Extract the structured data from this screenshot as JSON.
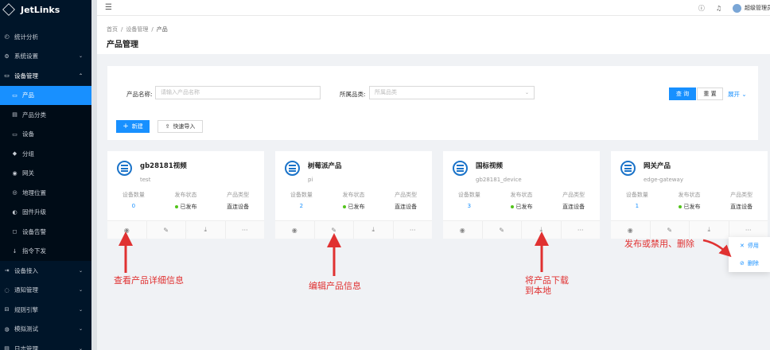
{
  "app": {
    "logo_text": "JetLinks"
  },
  "sidebar": {
    "items": [
      {
        "label": "统计分析",
        "icon": "dashboard-icon",
        "glyph": "◴",
        "type": "top",
        "arrow": ""
      },
      {
        "label": "系统设置",
        "icon": "gear-icon",
        "glyph": "⚙",
        "type": "top",
        "arrow": "⌄"
      },
      {
        "label": "设备管理",
        "icon": "device-icon",
        "glyph": "▭",
        "type": "open",
        "arrow": "⌃"
      },
      {
        "label": "产品",
        "icon": "laptop-icon",
        "glyph": "▭",
        "type": "active",
        "arrow": ""
      },
      {
        "label": "产品分类",
        "icon": "category-icon",
        "glyph": "▤",
        "type": "sub",
        "arrow": ""
      },
      {
        "label": "设备",
        "icon": "monitor-icon",
        "glyph": "▭",
        "type": "sub",
        "arrow": ""
      },
      {
        "label": "分组",
        "icon": "group-icon",
        "glyph": "◆",
        "type": "sub",
        "arrow": ""
      },
      {
        "label": "网关",
        "icon": "gateway-icon",
        "glyph": "◉",
        "type": "sub",
        "arrow": ""
      },
      {
        "label": "地理位置",
        "icon": "location-icon",
        "glyph": "◎",
        "type": "sub",
        "arrow": ""
      },
      {
        "label": "固件升级",
        "icon": "firmware-icon",
        "glyph": "◐",
        "type": "sub",
        "arrow": ""
      },
      {
        "label": "设备告警",
        "icon": "alarm-icon",
        "glyph": "◻",
        "type": "sub",
        "arrow": ""
      },
      {
        "label": "指令下发",
        "icon": "download-icon",
        "glyph": "↓",
        "type": "sub",
        "arrow": ""
      },
      {
        "label": "设备接入",
        "icon": "access-icon",
        "glyph": "⇥",
        "type": "top",
        "arrow": "⌄"
      },
      {
        "label": "通知管理",
        "icon": "notice-icon",
        "glyph": "◌",
        "type": "top",
        "arrow": "⌄"
      },
      {
        "label": "规则引擎",
        "icon": "rule-icon",
        "glyph": "⊟",
        "type": "top",
        "arrow": "⌄"
      },
      {
        "label": "模拟测试",
        "icon": "test-icon",
        "glyph": "◍",
        "type": "top",
        "arrow": "⌄"
      },
      {
        "label": "日志管理",
        "icon": "log-icon",
        "glyph": "▤",
        "type": "top",
        "arrow": "⌄"
      }
    ]
  },
  "header": {
    "username": "超级管理员"
  },
  "breadcrumb": [
    "首页",
    "设备管理",
    "产品"
  ],
  "page_title": "产品管理",
  "search": {
    "name_label": "产品名称:",
    "name_placeholder": "请输入产品名称",
    "category_label": "所属品类:",
    "category_placeholder": "所属品类",
    "query_button": "查 询",
    "reset_button": "重 置",
    "expand_link": "展开",
    "new_button": "新建",
    "import_button": "快速导入"
  },
  "card_labels": {
    "device_count": "设备数量",
    "publish_status": "发布状态",
    "product_type": "产品类型"
  },
  "products": [
    {
      "name": "gb28181视频",
      "id": "test",
      "count": "0",
      "status": "已发布",
      "type": "直连设备"
    },
    {
      "name": "树莓派产品",
      "id": "pi",
      "count": "2",
      "status": "已发布",
      "type": "直连设备"
    },
    {
      "name": "国标视频",
      "id": "gb28181_device",
      "count": "3",
      "status": "已发布",
      "type": "直连设备"
    },
    {
      "name": "网关产品",
      "id": "edge-gateway",
      "count": "1",
      "status": "已发布",
      "type": "直连设备"
    }
  ],
  "dropdown": {
    "disable_label": "停用",
    "delete_label": "删除"
  },
  "annotations": {
    "view": "查看产品详细信息",
    "edit": "编辑产品信息",
    "download_line1": "将产品下载",
    "download_line2": "到本地",
    "publish": "发布或禁用、删除"
  },
  "colors": {
    "primary": "#1890ff",
    "sidebar": "#001529",
    "annotation": "#e03131",
    "published": "#52c41a"
  }
}
